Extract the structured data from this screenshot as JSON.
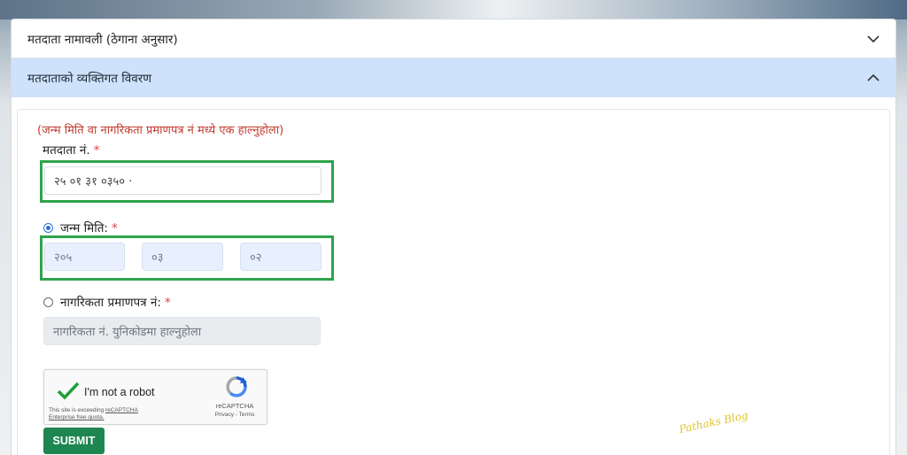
{
  "accordion": {
    "section1_title": "मतदाता नामावली (ठेगाना अनुसार)",
    "section2_title": "मतदाताको व्यक्तिगत विवरण"
  },
  "form": {
    "note": "(जन्म मिति वा नागरिकता प्रमाणपत्र नं मध्ये एक हाल्नुहोला)",
    "voter_no_label": "मतदाता नं.",
    "voter_no_value": "२५ ०१ ३१ ०३५० ·",
    "dob_label": "जन्म मिति:",
    "dob_year": "२०५",
    "dob_month": "०३",
    "dob_day": "०२",
    "citizenship_label": "नागरिकता प्रमाणपत्र नं:",
    "citizenship_placeholder": "नागरिकता नं. युनिकोडमा हाल्नुहोला",
    "required_mark": "*",
    "submit_label": "SUBMIT"
  },
  "captcha": {
    "label": "I'm not a robot",
    "notice_line1": "This site is exceeding",
    "notice_link": "reCAPTCHA",
    "notice_line2": "Enterprise free quota.",
    "brand": "reCAPTCHA",
    "links": "Privacy - Terms"
  },
  "watermark": "Pathaks Blog",
  "colors": {
    "accent": "#1e8650",
    "highlight": "#2fa34b",
    "note_red": "#c0392b",
    "expanded_header": "#cfe2fb"
  }
}
